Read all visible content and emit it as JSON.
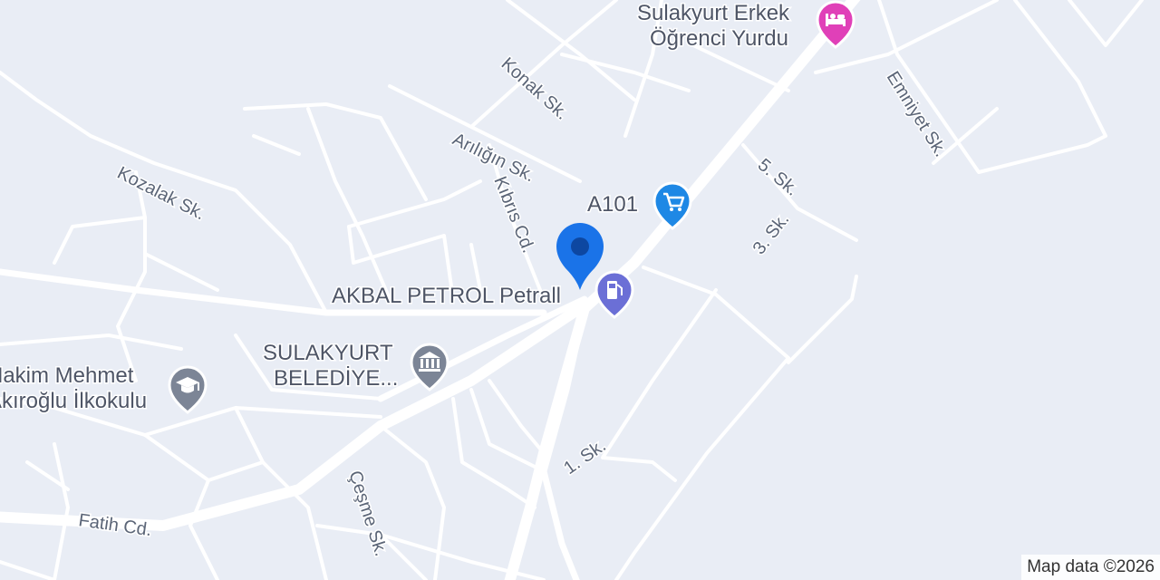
{
  "map": {
    "streets": {
      "konak": "Konak Sk.",
      "arilgin": "Arılığın Sk.",
      "kibris": "Kıbrıs Cd.",
      "kozalak": "Kozalak Sk.",
      "emniyet": "Emniyet Sk.",
      "bes": "5. Sk.",
      "uc": "3. Sk.",
      "bir": "1. Sk.",
      "cesme": "Çeşme Sk.",
      "fatih": "Fatih Cd."
    },
    "pois": {
      "dorm_line1": "Sulakyurt Erkek",
      "dorm_line2": "Öğrenci Yurdu",
      "a101": "A101",
      "petrol": "AKBAL PETROL Petrall",
      "municipality_line1": "SULAKYURT",
      "municipality_line2": "BELEDİYE...",
      "school_line1": "Hakim Mehmet",
      "school_line2": "Akıroğlu İlkokulu"
    },
    "icons": {
      "dorm": "bed-icon",
      "a101": "shopping-cart-icon",
      "petrol": "fuel-pump-icon",
      "municipality": "government-building-icon",
      "school": "graduation-cap-icon",
      "marker": "location-pin-icon"
    },
    "colors": {
      "background": "#e9edf5",
      "road": "#ffffff",
      "marker": "#1a73e8",
      "lodging": "#e040b8",
      "shopping": "#1e88e5",
      "fuel": "#6b6fd6",
      "civic": "#7c8596"
    },
    "attribution": "Map data ©2026"
  }
}
